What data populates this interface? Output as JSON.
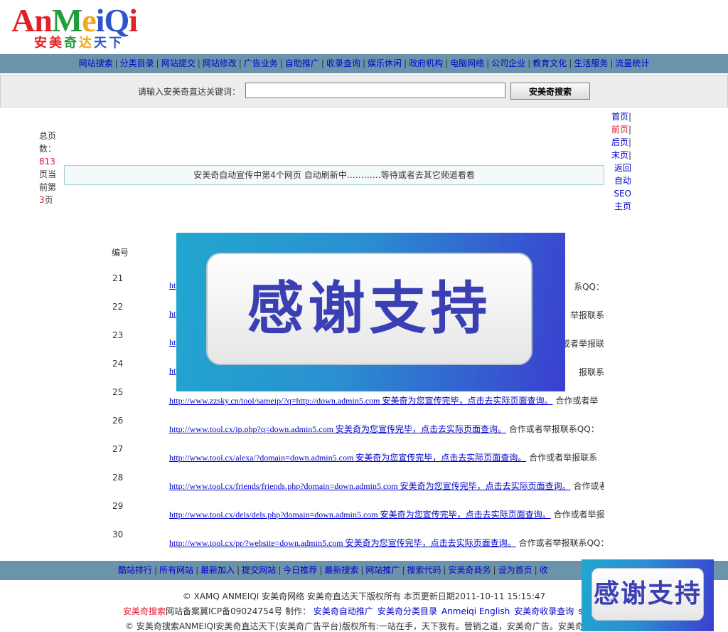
{
  "logo": {
    "text": "AnMeiQi",
    "letters": [
      {
        "ch": "A",
        "color": "#e01f26"
      },
      {
        "ch": "n",
        "color": "#e01f26"
      },
      {
        "ch": "M",
        "color": "#1f9e3a"
      },
      {
        "ch": "e",
        "color": "#f2a81d"
      },
      {
        "ch": "i",
        "color": "#2e55c9"
      },
      {
        "ch": "Q",
        "color": "#2e55c9"
      },
      {
        "ch": "i",
        "color": "#e01f26"
      }
    ],
    "slogan": "安美奇达天下",
    "slogan_letters": [
      {
        "ch": "安",
        "color": "#e01f26"
      },
      {
        "ch": "美",
        "color": "#e01f26"
      },
      {
        "ch": "奇",
        "color": "#1f9e3a"
      },
      {
        "ch": "达",
        "color": "#f2a81d"
      },
      {
        "ch": "天",
        "color": "#2e55c9"
      },
      {
        "ch": "下",
        "color": "#2e55c9"
      }
    ]
  },
  "top_nav": [
    "网站搜索",
    "分类目录",
    "网站提交",
    "网站修改",
    "广告业务",
    "自助推广",
    "收录查询",
    "娱乐休闲",
    "政府机构",
    "电脑网络",
    "公司企业",
    "教育文化",
    "生活服务",
    "流量统计"
  ],
  "search": {
    "label": "请输入安美奇直达关键词：",
    "value": "",
    "button": "安美奇搜索"
  },
  "left_info": {
    "total_label": "总页数：",
    "total": "813",
    "unit": "页",
    "current_prefix": "当前第",
    "current": "3",
    "current_suffix": "页"
  },
  "pager": {
    "first": "首页",
    "sep1": "|",
    "prev": "前页",
    "sep2": "|",
    "next": "后页",
    "sep3": "|",
    "last": "末页",
    "sep4": "|",
    "back": "返回自动SEO主页"
  },
  "notice": "安美奇自动宣传中第4个网页 自动刷新中…………等待或者去其它频道看看",
  "list": {
    "col_header": "编号",
    "rows": [
      {
        "num": "21",
        "url": "ht",
        "tail": "系QQ："
      },
      {
        "num": "22",
        "url": "ht",
        "tail": "举报联系"
      },
      {
        "num": "23",
        "url": "ht",
        "tail": "或者举报联"
      },
      {
        "num": "24",
        "url": "ht",
        "tail": "报联系"
      },
      {
        "num": "25",
        "url": "http://www.zzsky.cn/tool/sameip/?q=http://down.admin5.com",
        "text": " 安美奇为您宣传完毕，点击去实际页面查询。",
        "tail": " 合作或者举"
      },
      {
        "num": "26",
        "url": "http://www.tool.cx/ip.php?q=down.admin5.com",
        "text": " 安美奇为您宣传完毕，点击去实际页面查询。",
        "tail": " 合作或者举报联系QQ："
      },
      {
        "num": "27",
        "url": "http://www.tool.cx/alexa/?domain=down.admin5.com",
        "text": " 安美奇为您宣传完毕，点击去实际页面查询。",
        "tail": " 合作或者举报联系"
      },
      {
        "num": "28",
        "url": "http://www.tool.cx/friends/friends.php?domain=down.admin5.com",
        "text": " 安美奇为您宣传完毕，点击去实际页面查询。",
        "tail": " 合作或者"
      },
      {
        "num": "29",
        "url": "http://www.tool.cx/dels/dels.php?domain=down.admin5.com",
        "text": " 安美奇为您宣传完毕，点击去实际页面查询。",
        "tail": " 合作或者举报"
      },
      {
        "num": "30",
        "url": "http://www.tool.cx/pr/?website=down.admin5.com",
        "text": " 安美奇为您宣传完毕，点击去实际页面查询。",
        "tail": " 合作或者举报联系QQ："
      }
    ]
  },
  "banner": {
    "text": "感谢支持"
  },
  "bottom_nav": [
    "酷站排行",
    "所有网站",
    "最新加入",
    "提交网站",
    "今日推荐",
    "最新搜索",
    "网站推广",
    "搜索代码",
    "安美奇商务",
    "设为首页",
    "收"
  ],
  "footer": {
    "line1": "© XAMQ ANMEIQI 安美奇网络  安美奇直达天下版权所有  本页更新日期2011-10-11 15:15:47",
    "brand": "安美奇搜索",
    "icp": "网站备案冀ICP备09024754号",
    "make_label": "制作：",
    "links": [
      "安美奇自动推广",
      "安美奇分类目录",
      "Anmeiqi English",
      "安美奇收录查询",
      "sit"
    ],
    "line3": "© 安美奇搜索ANMEIQI安美奇直达天下(安美奇广告平台)版权所有:一站在手，天下我有。营销之道，安美奇广告。安美奇商"
  }
}
